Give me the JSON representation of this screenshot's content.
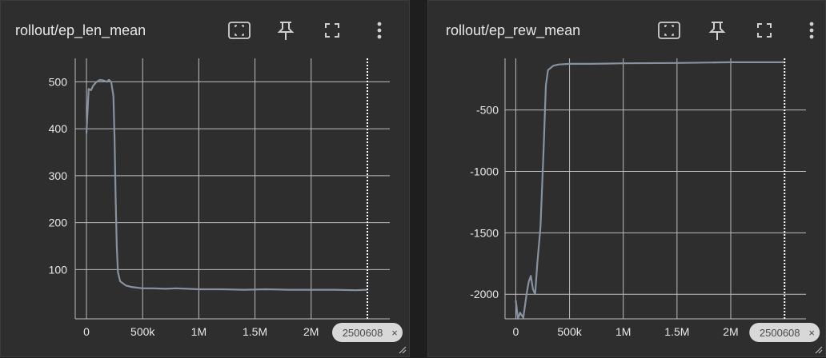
{
  "colors": {
    "background": "#1e1e1e",
    "panel": "#2e2e2e",
    "grid": "#bdbdbd",
    "line": "#8593a0",
    "text": "#e8e8e8"
  },
  "toolbar_icons": [
    "fit-domain-icon",
    "pin-icon",
    "fullscreen-icon",
    "more-vert-icon"
  ],
  "chart_data": [
    {
      "type": "line",
      "title": "rollout/ep_len_mean",
      "xlabel": "",
      "ylabel": "",
      "x_ticks": [
        "0",
        "500k",
        "1M",
        "1.5M",
        "2M"
      ],
      "y_ticks": [
        "100",
        "200",
        "300",
        "400",
        "500"
      ],
      "xlim": [
        -100000,
        2700000
      ],
      "ylim": [
        -5,
        550
      ],
      "grid": true,
      "cursor_step": 2500608,
      "cursor_label": "2500608",
      "series": [
        {
          "x": [
            0,
            20000,
            40000,
            60000,
            90000,
            120000,
            150000,
            180000,
            200000,
            220000,
            240000,
            250000,
            260000,
            270000,
            280000,
            300000,
            350000,
            400000,
            500000,
            600000,
            700000,
            800000,
            900000,
            1000000,
            1200000,
            1400000,
            1600000,
            1800000,
            2000000,
            2200000,
            2400000,
            2500000
          ],
          "y": [
            390,
            485,
            482,
            492,
            500,
            504,
            503,
            500,
            504,
            500,
            470,
            380,
            250,
            150,
            95,
            75,
            66,
            63,
            60,
            60,
            59,
            60,
            59,
            58,
            58,
            57,
            58,
            57,
            57,
            57,
            56,
            57
          ]
        }
      ]
    },
    {
      "type": "line",
      "title": "rollout/ep_rew_mean",
      "xlabel": "",
      "ylabel": "",
      "x_ticks": [
        "0",
        "500k",
        "1M",
        "1.5M",
        "2M"
      ],
      "y_ticks": [
        "-500",
        "-1000",
        "-1500",
        "-2000"
      ],
      "xlim": [
        -100000,
        2700000
      ],
      "ylim": [
        -2200,
        -80
      ],
      "grid": true,
      "cursor_step": 2500608,
      "cursor_label": "2500608",
      "series": [
        {
          "x": [
            0,
            20000,
            40000,
            70000,
            100000,
            120000,
            140000,
            160000,
            180000,
            200000,
            230000,
            260000,
            280000,
            300000,
            350000,
            400000,
            500000,
            700000,
            1000000,
            1500000,
            2000000,
            2500000
          ],
          "y": [
            -2050,
            -2200,
            -2150,
            -2190,
            -2000,
            -1900,
            -1850,
            -1960,
            -2000,
            -1750,
            -1450,
            -800,
            -300,
            -175,
            -140,
            -130,
            -125,
            -125,
            -120,
            -118,
            -112,
            -112
          ]
        }
      ]
    }
  ]
}
